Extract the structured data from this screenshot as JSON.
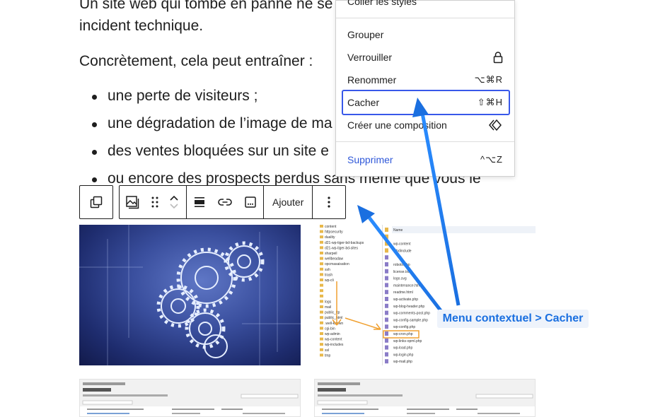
{
  "article": {
    "line1": "Un site web qui tombe en panne ne se",
    "line2": "incident technique.",
    "intro": "Concrètement, cela peut entraîner :",
    "bullets": [
      "une perte de visiteurs ;",
      "une dégradation de l’image de ma",
      "des ventes bloquées sur un site e",
      "ou encore des prospects perdus sans même que vous le"
    ]
  },
  "toolbar": {
    "add_label": "Ajouter"
  },
  "menu": {
    "paste_styles": "Coller les styles",
    "group": "Grouper",
    "lock": "Verrouiller",
    "rename": "Renommer",
    "rename_shortcut": "⌥⌘R",
    "hide": "Cacher",
    "hide_shortcut": "⇧⌘H",
    "create_pattern": "Créer une composition",
    "delete": "Supprimer",
    "delete_shortcut": "^⌥Z"
  },
  "annotation": {
    "callout": "Menu contextuel > Cacher",
    "color": "#1a6fe0"
  },
  "ftp": {
    "left_tree": [
      "content",
      "httpsecurity",
      "duality",
      "d21-wp-tiger-bd-backups",
      "d21-wp-tiger-bd-sites",
      "sharpeil",
      "wellbeadaw",
      "opcmasaisation",
      "ssh",
      "trash",
      "wp-cli",
      "",
      "",
      "",
      "logs",
      "mail",
      "public_ftp",
      "public_html",
      ".well-known",
      "cgi-bin",
      "wp-admin",
      "wp-content",
      "wp-includes",
      "ssl",
      "tmp"
    ],
    "right_list": [
      "Name",
      "",
      "wp-content",
      "mbdinclude",
      "",
      "robots.php",
      "license.txt",
      "logo.svg",
      "maintenance.html",
      "readme.html",
      "wp-activate.php",
      "wp-blog-header.php",
      "wp-comments-post.php",
      "wp-config-sample.php",
      "wp-config.php",
      "wp-cron.php",
      "wp-links-opml.php",
      "wp-load.php",
      "wp-login.php",
      "wp-mail.php"
    ]
  }
}
